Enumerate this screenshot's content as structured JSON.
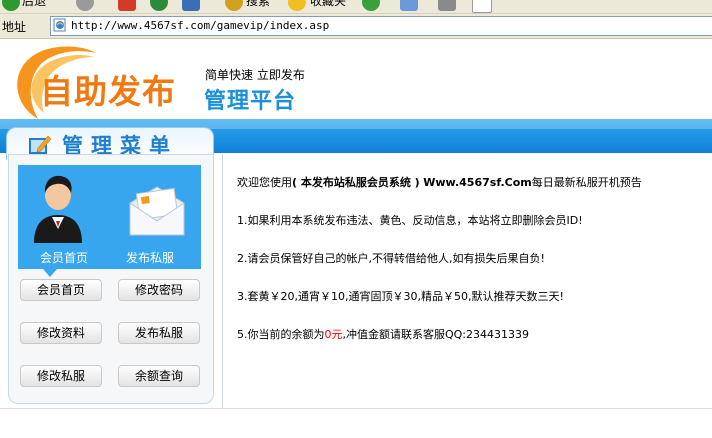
{
  "browser": {
    "toolbar": {
      "back_label": "后退",
      "search_label": "搜索",
      "favorites_label": "收藏夹"
    },
    "address": {
      "label": "地址",
      "url": "http://www.4567sf.com/gamevip/index.asp"
    }
  },
  "header": {
    "logo_main": "自助发布",
    "slogan": "简单快速 立即发布",
    "sub_title": "管理平台"
  },
  "menu": {
    "title": "管理菜单",
    "hero_left_label": "会员首页",
    "hero_right_label": "发布私服",
    "buttons": [
      {
        "label": "会员首页"
      },
      {
        "label": "修改密码"
      },
      {
        "label": "修改资料"
      },
      {
        "label": "发布私服"
      },
      {
        "label": "修改私服"
      },
      {
        "label": "余额查询"
      }
    ]
  },
  "content": {
    "welcome_prefix": "欢迎您使用",
    "welcome_bold": "( 本发布站私服会员系统 )",
    "welcome_site": "Www.4567sf.Com",
    "welcome_suffix": "每日最新私服开机预告",
    "notice1": "1.如果利用本系统发布违法、黄色、反动信息，本站将立即删除会员ID!",
    "notice2": "2.请会员保管好自己的帐户,不得转借给他人,如有损失后果自负!",
    "notice3": "3.套黄￥20,通宵￥10,通宵固顶￥30,精品￥50,默认推荐天数三天!",
    "notice5_prefix": "5.你当前的余额为",
    "notice5_balance": "0元",
    "notice5_suffix": ",冲值金额请联系客服QQ:234431339"
  },
  "colors": {
    "brand_orange": "#f07a10",
    "brand_blue": "#1a90d8",
    "hero_blue": "#37a6ee",
    "balance_red": "#ff0000"
  }
}
